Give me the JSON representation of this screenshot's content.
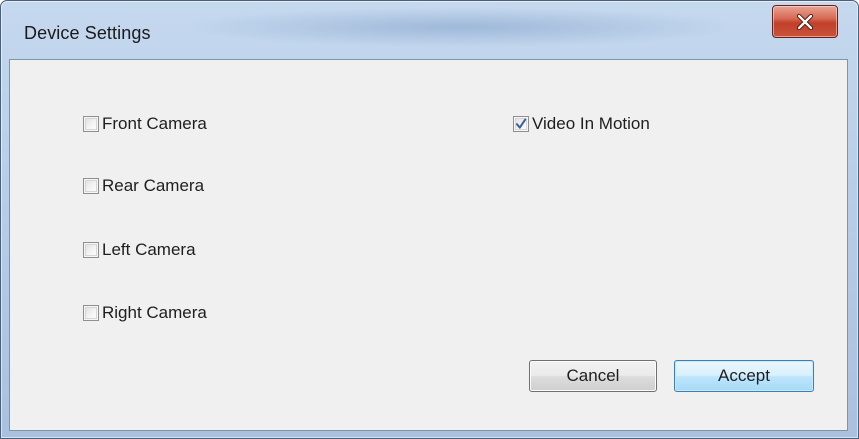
{
  "window": {
    "title": "Device Settings"
  },
  "titlebar": {
    "close_icon": "close-icon",
    "close_color": "#c7432d"
  },
  "checkboxes": [
    {
      "label": "Front Camera",
      "checked": false
    },
    {
      "label": "Rear Camera",
      "checked": false
    },
    {
      "label": "Left Camera",
      "checked": false
    },
    {
      "label": "Right Camera",
      "checked": false
    },
    {
      "label": "Video In Motion",
      "checked": true
    }
  ],
  "buttons": {
    "cancel_label": "Cancel",
    "accept_label": "Accept"
  },
  "colors": {
    "titlebar": "#b7cde8",
    "client_background": "#f0f0f0",
    "default_button_border": "#3c7fb1",
    "checkmark": "#3a5fa0"
  }
}
